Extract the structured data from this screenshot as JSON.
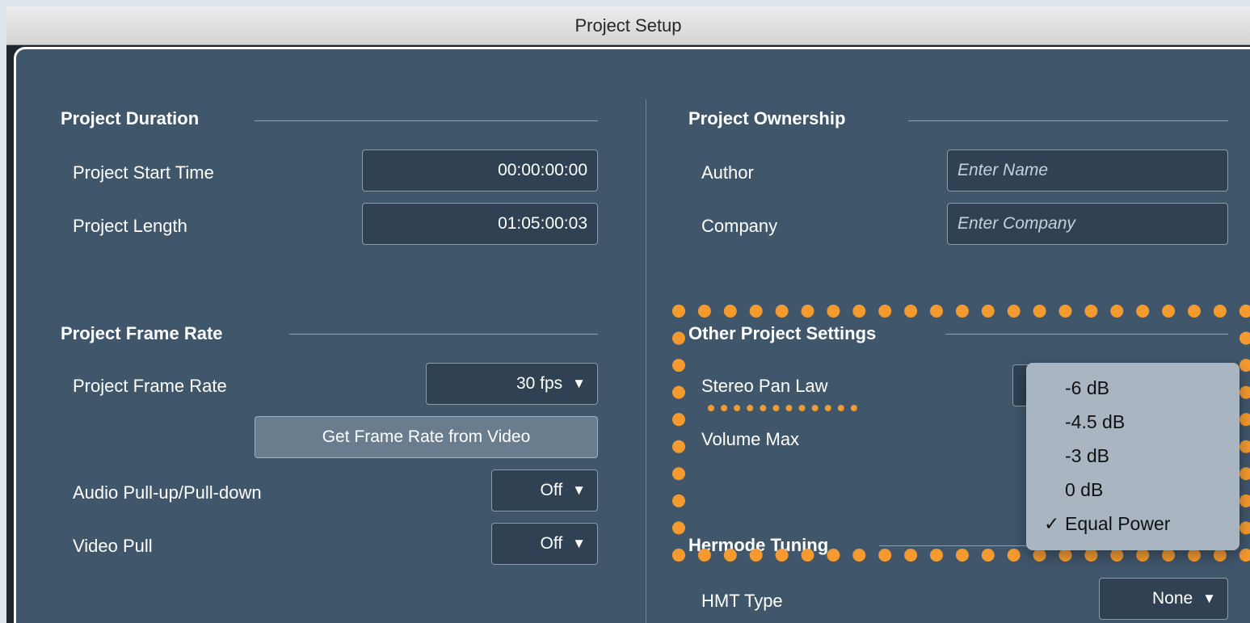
{
  "window": {
    "title": "Project Setup"
  },
  "project_duration": {
    "title": "Project Duration",
    "start_time_label": "Project Start Time",
    "start_time_value": "00:00:00:00",
    "length_label": "Project Length",
    "length_value": "01:05:00:03"
  },
  "frame_rate": {
    "title": "Project Frame Rate",
    "rate_label": "Project Frame Rate",
    "rate_value": "30 fps",
    "get_from_video_button": "Get Frame Rate from Video",
    "pull_label": "Audio Pull-up/Pull-down",
    "pull_value": "Off",
    "video_pull_label": "Video Pull",
    "video_pull_value": "Off"
  },
  "ownership": {
    "title": "Project Ownership",
    "author_label": "Author",
    "author_placeholder": "Enter Name",
    "company_label": "Company",
    "company_placeholder": "Enter Company"
  },
  "other": {
    "title": "Other Project Settings",
    "pan_law_label": "Stereo Pan Law",
    "volume_max_label": "Volume Max",
    "pan_law_options": [
      {
        "label": "-6 dB",
        "checked": ""
      },
      {
        "label": "-4.5 dB",
        "checked": ""
      },
      {
        "label": "-3 dB",
        "checked": ""
      },
      {
        "label": "0 dB",
        "checked": ""
      },
      {
        "label": "Equal Power",
        "checked": "✓"
      }
    ]
  },
  "hermode": {
    "title": "Hermode Tuning",
    "hmt_label": "HMT Type",
    "hmt_value": "None"
  },
  "icons": {
    "dropdown": "▼"
  },
  "colors": {
    "highlight": "#f49a2e",
    "panel": "#40566b"
  }
}
